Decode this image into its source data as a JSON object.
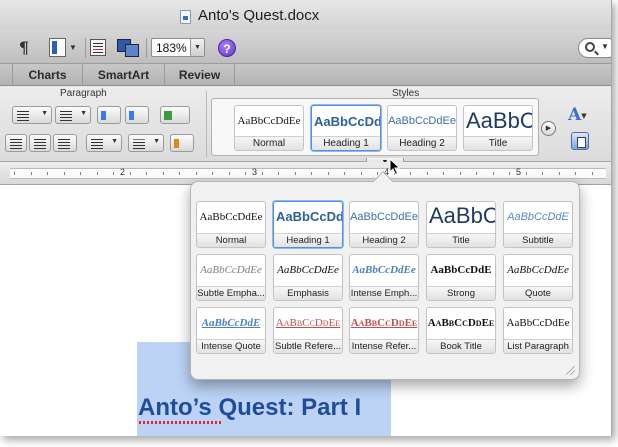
{
  "window": {
    "title": "Anto's Quest.docx"
  },
  "toolbar": {
    "pilcrow": "¶",
    "zoom": "183%",
    "help": "?"
  },
  "ribbon_tabs": [
    {
      "label": "Charts"
    },
    {
      "label": "SmartArt"
    },
    {
      "label": "Review"
    }
  ],
  "ribbon": {
    "paragraph_label": "Paragraph",
    "styles_label": "Styles",
    "gallery": [
      {
        "sample": "AaBbCcDdEe",
        "label": "Normal"
      },
      {
        "sample": "AaBbCcDd",
        "label": "Heading 1"
      },
      {
        "sample": "AaBbCcDdEe",
        "label": "Heading 2"
      },
      {
        "sample": "AaBbC",
        "label": "Title"
      }
    ],
    "text_effects": "A"
  },
  "ruler": {
    "numbers": [
      "2",
      "3",
      "4",
      "5"
    ]
  },
  "styles_popup": {
    "rows": [
      [
        {
          "sample": "AaBbCcDdEe",
          "label": "Normal",
          "style": "s-normal"
        },
        {
          "sample": "AaBbCcDd",
          "label": "Heading 1",
          "style": "s-heading1"
        },
        {
          "sample": "AaBbCcDdEe",
          "label": "Heading 2",
          "style": "s-heading2"
        },
        {
          "sample": "AaBbC",
          "label": "Title",
          "style": "s-title"
        },
        {
          "sample": "AaBbCcDdE",
          "label": "Subtitle",
          "style": "s-subtitle"
        }
      ],
      [
        {
          "sample": "AaBbCcDdEe",
          "label": "Subtle Empha...",
          "style": "s-subtle-emph"
        },
        {
          "sample": "AaBbCcDdEe",
          "label": "Emphasis",
          "style": "s-emphasis"
        },
        {
          "sample": "AaBbCcDdEe",
          "label": "Intense Emph...",
          "style": "s-intense-emph"
        },
        {
          "sample": "AaBbCcDdE",
          "label": "Strong",
          "style": "s-strong"
        },
        {
          "sample": "AaBbCcDdEe",
          "label": "Quote",
          "style": "s-quote"
        }
      ],
      [
        {
          "sample": "AaBbCcDdE",
          "label": "Intense Quote",
          "style": "s-intense-quote"
        },
        {
          "sample": "AaBbCcDdEe",
          "label": "Subtle Refere...",
          "style": "s-subtle-ref"
        },
        {
          "sample": "AaBbCcDdEe",
          "label": "Intense Refer...",
          "style": "s-intense-ref"
        },
        {
          "sample": "AaBbCcDdEe",
          "label": "Book Title",
          "style": "s-book-title"
        },
        {
          "sample": "AaBbCcDdEe",
          "label": "List Paragraph",
          "style": "s-list-para"
        }
      ]
    ]
  },
  "document": {
    "heading": "Anto’s Quest: Part I"
  },
  "colors": {
    "selection": "#bcd3f5",
    "heading_blue": "#1f4d9c",
    "selected_tile_border": "#5a8fd8"
  }
}
